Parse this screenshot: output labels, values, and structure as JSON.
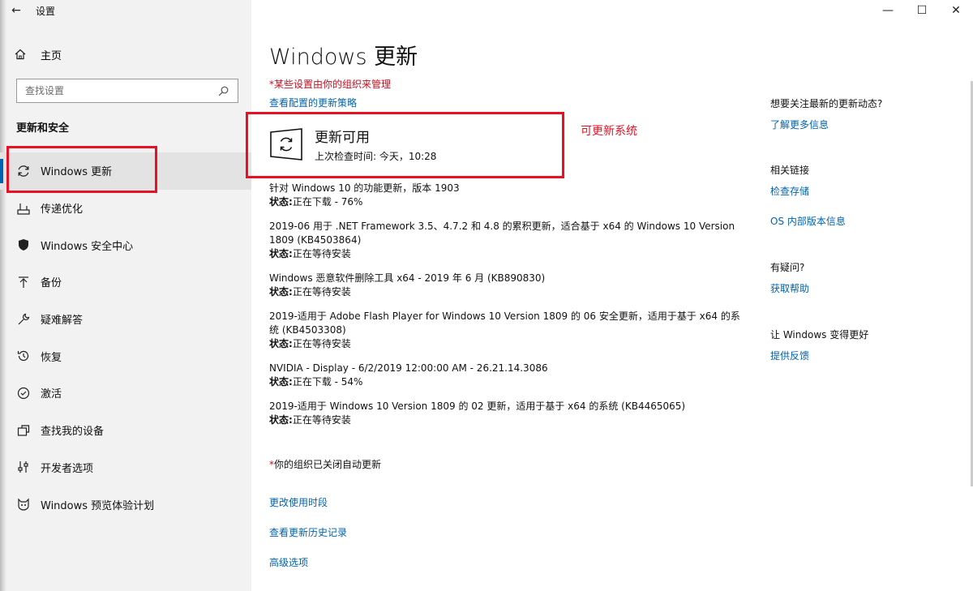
{
  "window": {
    "title": "设置",
    "back_icon": "←",
    "controls": [
      "—",
      "☐",
      "✕"
    ]
  },
  "sidebar": {
    "home_label": "主页",
    "search_placeholder": "查找设置",
    "section_title": "更新和安全",
    "items": [
      {
        "label": "Windows 更新",
        "icon": "sync-icon",
        "active": true
      },
      {
        "label": "传递优化",
        "icon": "delivery-icon"
      },
      {
        "label": "Windows 安全中心",
        "icon": "shield-icon"
      },
      {
        "label": "备份",
        "icon": "backup-arrow-icon"
      },
      {
        "label": "疑难解答",
        "icon": "wrench-icon"
      },
      {
        "label": "恢复",
        "icon": "history-icon"
      },
      {
        "label": "激活",
        "icon": "check-circle-icon"
      },
      {
        "label": "查找我的设备",
        "icon": "find-device-icon"
      },
      {
        "label": "开发者选项",
        "icon": "dev-sliders-icon"
      },
      {
        "label": "Windows 预览体验计划",
        "icon": "insider-cat-icon"
      }
    ]
  },
  "main": {
    "title": "Windows 更新",
    "org_note": "*某些设置由你的组织来管理",
    "policy_link": "查看配置的更新策略",
    "status": {
      "heading": "更新可用",
      "last_check": "上次检查时间: 今天，10:28"
    },
    "annotation": "可更新系统",
    "updates": [
      {
        "title": "针对 Windows 10 的功能更新，版本 1903",
        "status_label": "状态:",
        "status": "正在下载 - 76%"
      },
      {
        "title": "2019-06 用于 .NET Framework 3.5、4.7.2 和 4.8 的累积更新，适合基于 x64 的 Windows 10 Version 1809 (KB4503864)",
        "status_label": "状态:",
        "status": "正在等待安装"
      },
      {
        "title": "Windows 恶意软件删除工具 x64 - 2019 年 6 月 (KB890830)",
        "status_label": "状态:",
        "status": "正在等待安装"
      },
      {
        "title": "2019-适用于 Adobe Flash Player for Windows 10 Version 1809 的 06 安全更新，适用于基于 x64 的系统 (KB4503308)",
        "status_label": "状态:",
        "status": "正在等待安装"
      },
      {
        "title": "NVIDIA - Display - 6/2/2019 12:00:00 AM - 26.21.14.3086",
        "status_label": "状态:",
        "status": "正在下载 - 54%"
      },
      {
        "title": "2019-适用于 Windows 10 Version 1809 的 02 更新，适用于基于 x64 的系统 (KB4465065)",
        "status_label": "状态:",
        "status": "正在等待安装"
      }
    ],
    "auto_note_star": "*",
    "auto_note": "你的组织已关闭自动更新",
    "links": [
      "更改使用时段",
      "查看更新历史记录",
      "高级选项"
    ]
  },
  "right": {
    "g1_heading": "想要关注最新的更新动态?",
    "g1_link": "了解更多信息",
    "g2_heading": "相关链接",
    "g2_link1": "检查存储",
    "g2_link2": "OS 内部版本信息",
    "g3_heading": "有疑问?",
    "g3_link": "获取帮助",
    "g4_heading": "让 Windows 变得更好",
    "g4_link": "提供反馈"
  },
  "colors": {
    "accent": "#0063b1",
    "annotation_red": "#e81123",
    "warning_red": "#c50f1f"
  }
}
